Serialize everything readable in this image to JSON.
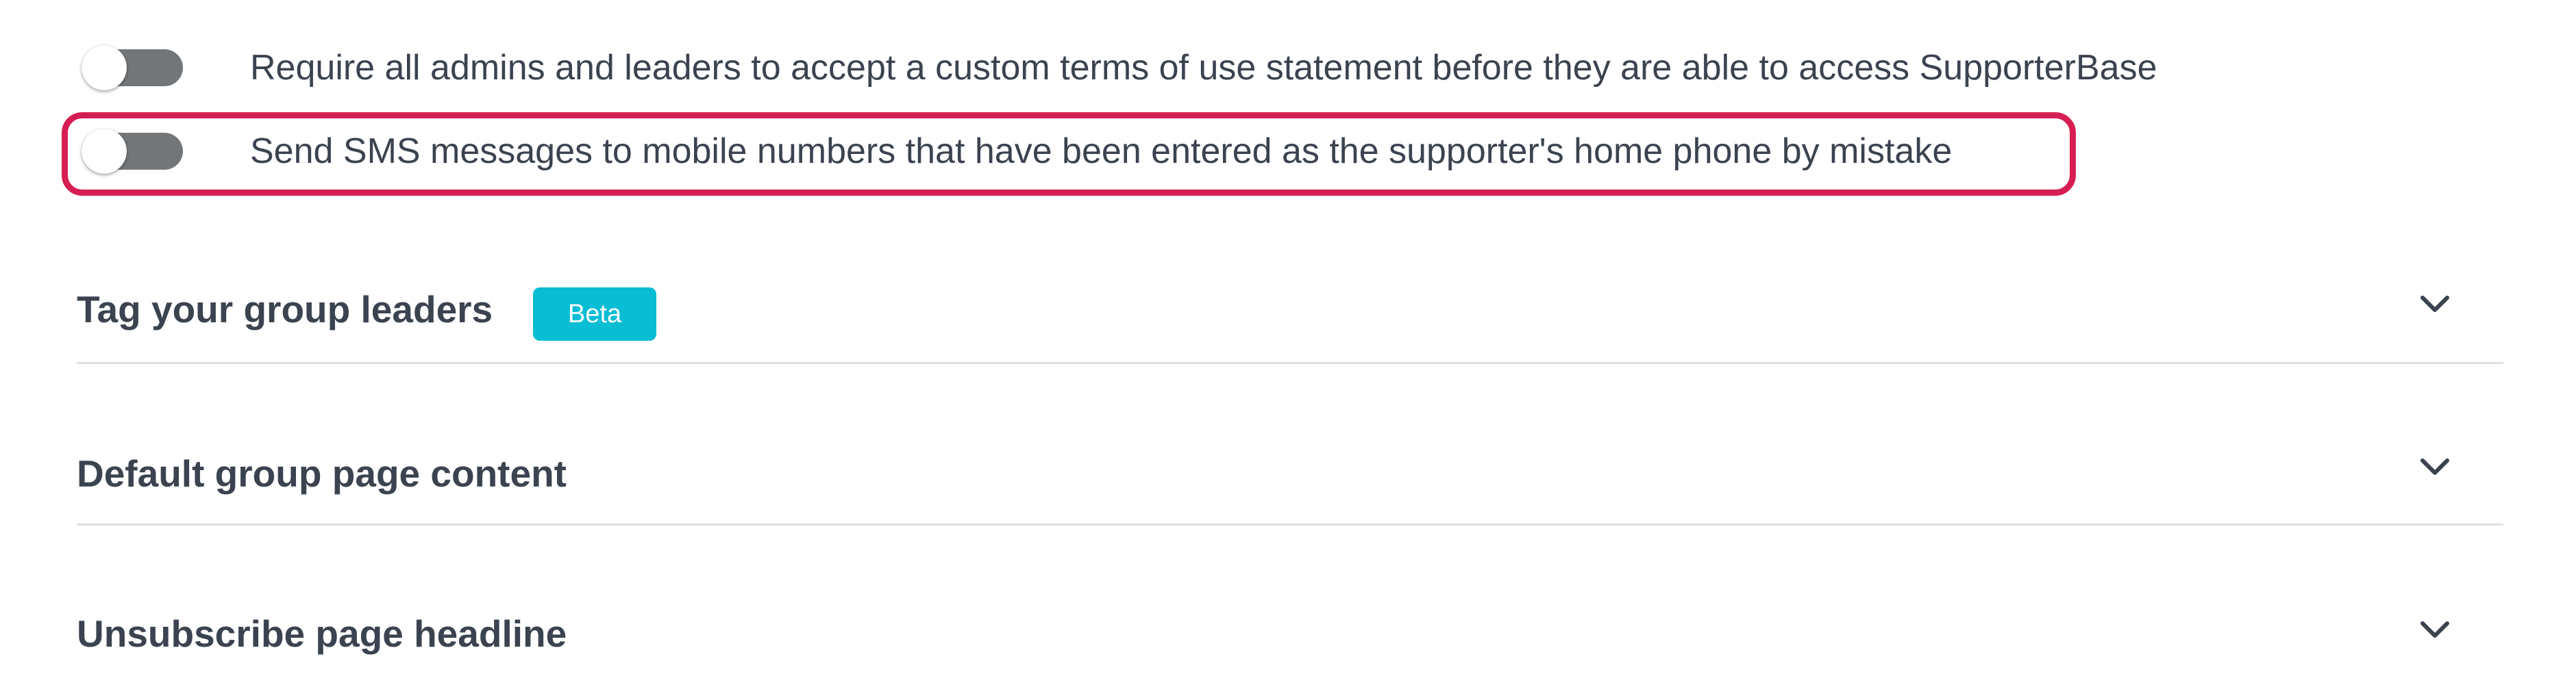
{
  "settings": {
    "toggles": [
      {
        "label": "Require all admins and leaders to accept a custom terms of use statement before they are able to access SupporterBase",
        "enabled": false
      },
      {
        "label": "Send SMS messages to mobile numbers that have been entered as the supporter's home phone by mistake",
        "enabled": false,
        "highlighted": true
      }
    ]
  },
  "sections": [
    {
      "title": "Tag your group leaders",
      "badge": "Beta",
      "icon": "chevron-down-icon"
    },
    {
      "title": "Default group page content",
      "icon": "chevron-down-icon"
    },
    {
      "title": "Unsubscribe page headline",
      "icon": "chevron-down-icon"
    }
  ],
  "colors": {
    "highlight_border": "#d61e52",
    "badge_background": "#08bdd4",
    "toggle_track_off": "#737679",
    "text": "#3b4350",
    "divider": "#dde1e6"
  }
}
